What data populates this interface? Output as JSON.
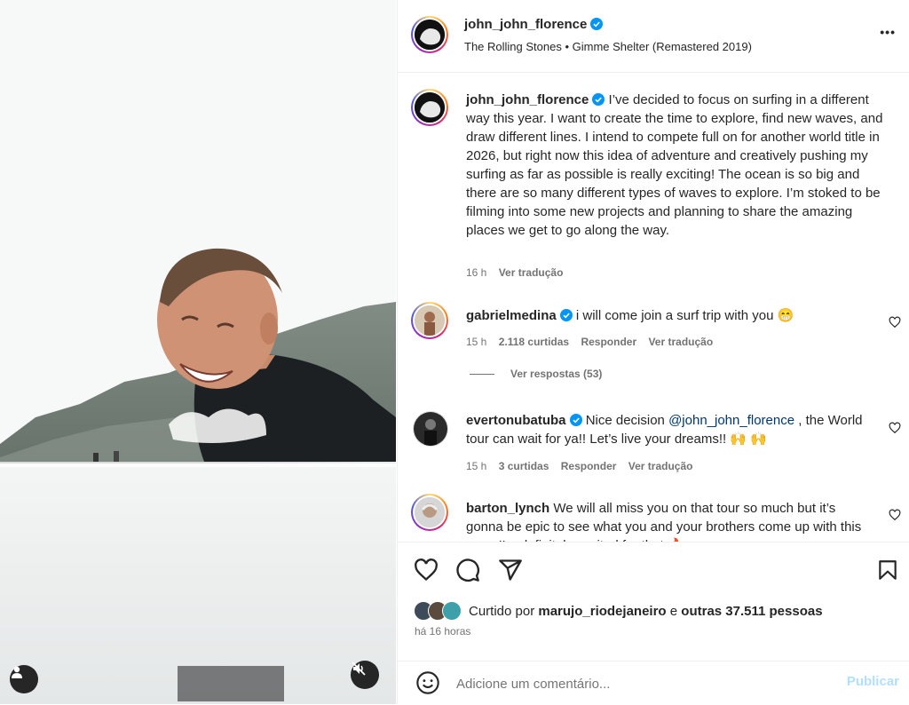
{
  "post": {
    "username": "john_john_florence",
    "music": "The Rolling Stones • Gimme Shelter (Remastered 2019)",
    "more_label": "•••"
  },
  "caption": {
    "username": "john_john_florence",
    "text": "I’ve decided to focus on surfing in a different way this year. I want to create the time to explore, find new waves, and draw different lines. I intend to compete full on for another world title in 2026, but right now this idea of adventure and creatively pushing my surfing as far as possible is really exciting! The ocean is so big and there are so many different types of waves to explore. I’m stoked to be filming into some new projects and planning to share the amazing places we get to go along the way.",
    "time": "16 h",
    "translate": "Ver tradução"
  },
  "comments": [
    {
      "username": "gabrielmedina",
      "verified": true,
      "text": "i will come join a surf trip with you 😁",
      "time": "15 h",
      "likes": "2.118 curtidas",
      "reply": "Responder",
      "translate": "Ver tradução",
      "replies": "Ver respostas (53)"
    },
    {
      "username": "evertonubatuba",
      "verified": true,
      "text_before": "Nice decision",
      "mention": "@john_john_florence",
      "text_after": ", the World tour can wait for ya!! Let’s live your dreams!! 🙌 🙌",
      "time": "15 h",
      "likes": "3 curtidas",
      "reply": "Responder",
      "translate": "Ver tradução"
    },
    {
      "username": "barton_lynch",
      "verified": false,
      "text": "We will all miss you on that tour so much but it’s gonna be epic to see what you and your brothers come up with this year. I’m definitely excited for that 🔥"
    }
  ],
  "likes": {
    "prefix": "Curtido por",
    "user": "marujo_riodejaneiro",
    "and": "e",
    "others": "outras 37.511 pessoas"
  },
  "post_time": "há 16 horas",
  "comment_input": {
    "placeholder": "Adicione um comentário...",
    "publish": "Publicar"
  },
  "icons": {
    "heart": "heart-icon",
    "comment": "comment-icon",
    "share": "share-icon",
    "save": "bookmark-icon",
    "emoji": "emoji-icon",
    "mute": "mute-icon",
    "user": "user-icon"
  },
  "colors": {
    "verified": "#0095f6",
    "link": "#00376b",
    "publish": "#b2dffc"
  }
}
